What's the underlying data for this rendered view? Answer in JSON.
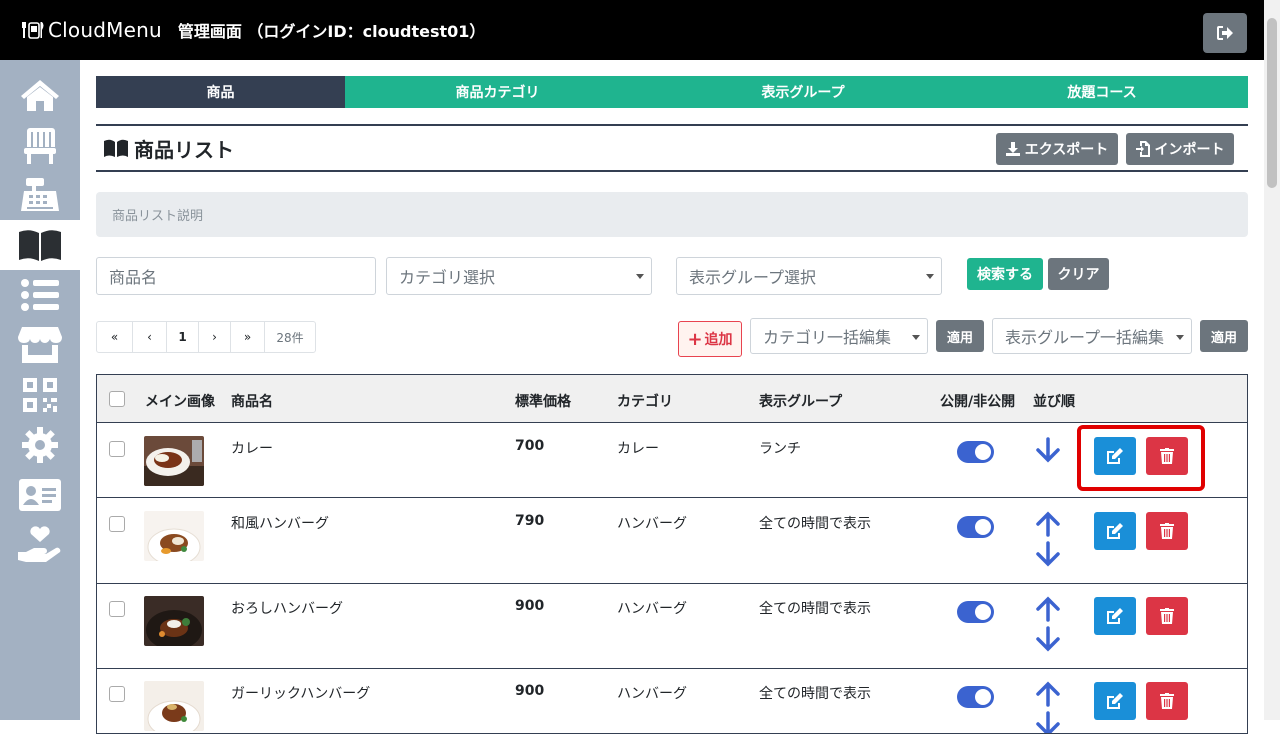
{
  "header": {
    "logo_text": "CloudMenu",
    "admin_title": "管理画面 （ログインID：cloudtest01）"
  },
  "sidebar": {
    "items": [
      {
        "name": "home-icon"
      },
      {
        "name": "chair-icon"
      },
      {
        "name": "register-icon"
      },
      {
        "name": "book-icon",
        "active": true
      },
      {
        "name": "list-icon"
      },
      {
        "name": "store-icon"
      },
      {
        "name": "qrcode-icon"
      },
      {
        "name": "gear-icon"
      },
      {
        "name": "id-card-icon"
      },
      {
        "name": "hand-heart-icon"
      }
    ]
  },
  "tabs": [
    {
      "label": "商品",
      "active": true
    },
    {
      "label": "商品カテゴリ"
    },
    {
      "label": "表示グループ"
    },
    {
      "label": "放題コース"
    }
  ],
  "list": {
    "title": "商品リスト",
    "export_label": "エクスポート",
    "import_label": "インポート",
    "description_placeholder": "商品リスト説明"
  },
  "search": {
    "name_placeholder": "商品名",
    "category_placeholder": "カテゴリ選択",
    "group_placeholder": "表示グループ選択",
    "search_label": "検索する",
    "clear_label": "クリア"
  },
  "pager": {
    "first": "«",
    "prev": "‹",
    "page": "1",
    "next": "›",
    "last": "»",
    "count": "28件"
  },
  "bulk": {
    "add_label": "追加",
    "category_bulk": "カテゴリ一括編集",
    "apply1": "適用",
    "group_bulk": "表示グループ一括編集",
    "apply2": "適用"
  },
  "table": {
    "headers": {
      "image": "メイン画像",
      "name": "商品名",
      "price": "標準価格",
      "category": "カテゴリ",
      "group": "表示グループ",
      "public": "公開/非公開",
      "order": "並び順"
    },
    "rows": [
      {
        "name": "カレー",
        "price": "700",
        "category": "カレー",
        "group": "ランチ",
        "published": true
      },
      {
        "name": "和風ハンバーグ",
        "price": "790",
        "category": "ハンバーグ",
        "group": "全ての時間で表示",
        "published": true
      },
      {
        "name": "おろしハンバーグ",
        "price": "900",
        "category": "ハンバーグ",
        "group": "全ての時間で表示",
        "published": true
      },
      {
        "name": "ガーリックハンバーグ",
        "price": "900",
        "category": "ハンバーグ",
        "group": "全ての時間で表示",
        "published": true
      }
    ]
  },
  "colors": {
    "tab_active": "#343f52",
    "tab": "#1fb48f",
    "toggle": "#3b63d0",
    "edit": "#1a8fd8",
    "delete": "#dc3545",
    "highlight": "#e00000"
  }
}
